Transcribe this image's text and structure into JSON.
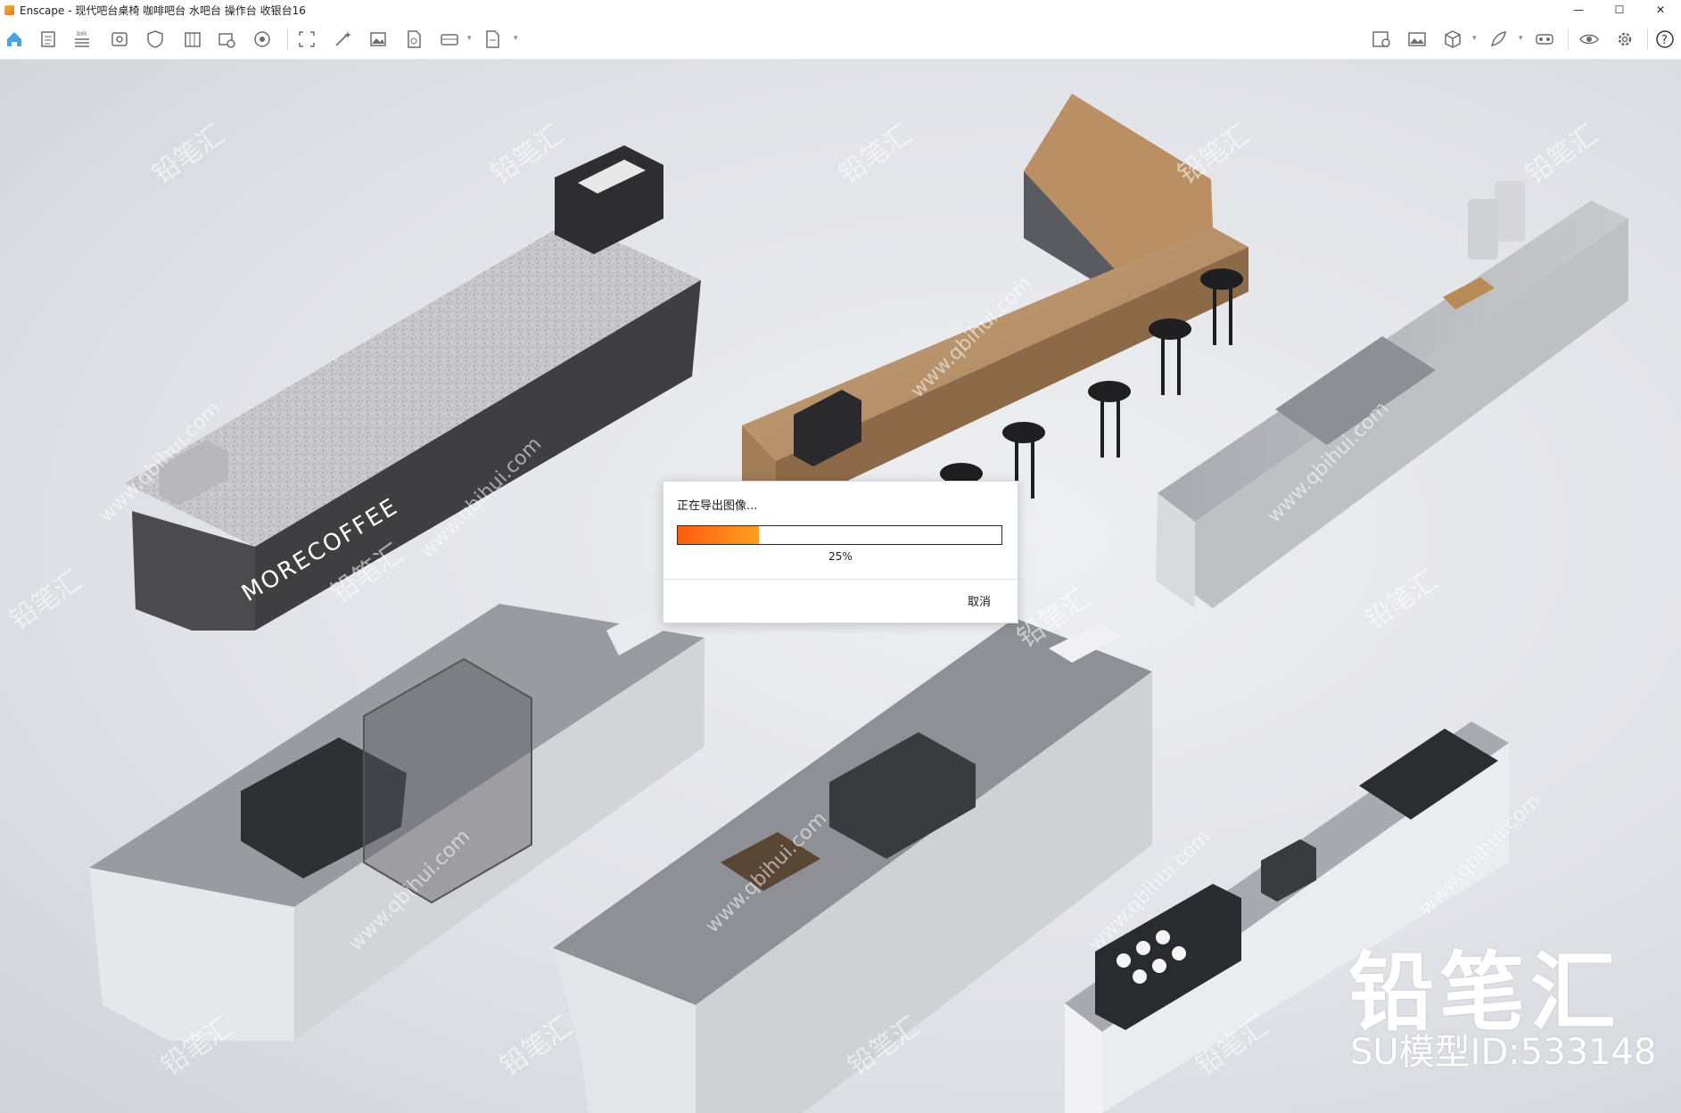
{
  "window": {
    "app_name": "Enscape",
    "title": "Enscape - 现代吧台桌椅 咖啡吧台 水吧台 操作台 收银台16",
    "minimize": "—",
    "maximize": "☐",
    "close": "✕"
  },
  "toolbar": {
    "left_icons": [
      "home-icon",
      "notes-icon",
      "bim-icon",
      "view-icon",
      "shield-icon",
      "library-icon",
      "asset-icon",
      "settings-wheel-icon",
      "screenshot-icon",
      "magic-icon",
      "image-icon",
      "file-icon",
      "panorama-icon",
      "export-icon"
    ],
    "right_icons": [
      "map-pin-icon",
      "gallery-icon",
      "cube-icon",
      "feather-icon",
      "vr-icon",
      "eye-icon",
      "gear-icon",
      "help-icon"
    ],
    "bim_label": "BIM",
    "help_label": "?"
  },
  "scene": {
    "counter_brand_text": "MORECOFFEE",
    "watermark_site": "www.qbihui.com",
    "watermark_brand": "铅笔汇",
    "brand_logo": "铅笔汇",
    "model_id": "SU模型ID:533148"
  },
  "dialog": {
    "title": "正在导出图像...",
    "progress_percent": 25,
    "progress_label": "25%",
    "cancel_label": "取消",
    "accent_start": "#ff5a10",
    "accent_end": "#ffa020"
  }
}
